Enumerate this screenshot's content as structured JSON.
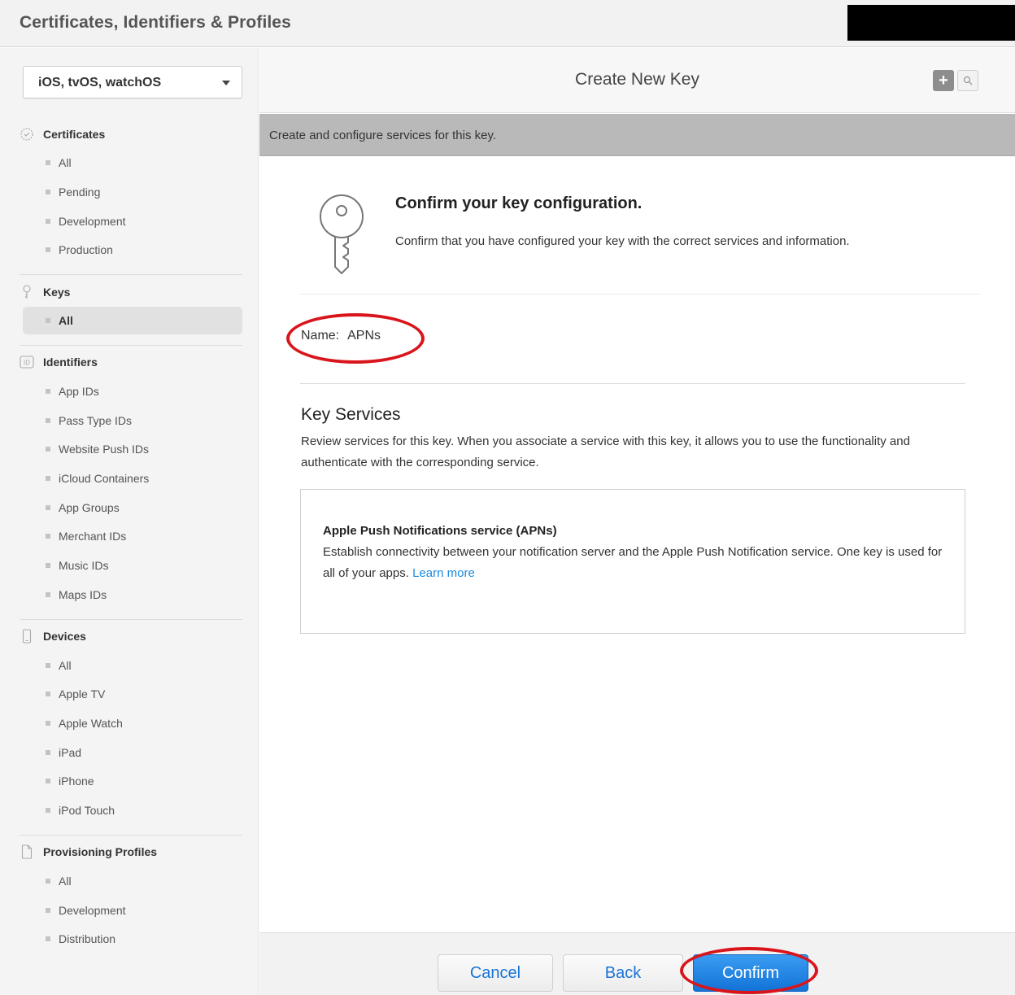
{
  "app_title": "Certificates, Identifiers & Profiles",
  "colors": {
    "annotation": "#d9151c",
    "link": "#1a8be0",
    "primary_button": "#1a74d6"
  },
  "sidebar": {
    "platform_selector": {
      "selected": "iOS, tvOS, watchOS",
      "icon": "chevron-down-icon"
    },
    "sections": [
      {
        "label": "Certificates",
        "icon": "certificate-icon",
        "items": [
          "All",
          "Pending",
          "Development",
          "Production"
        ]
      },
      {
        "label": "Keys",
        "icon": "key-icon",
        "items": [
          "All"
        ],
        "active_item": "All"
      },
      {
        "label": "Identifiers",
        "icon": "id-icon",
        "icon_text": "ID",
        "items": [
          "App IDs",
          "Pass Type IDs",
          "Website Push IDs",
          "iCloud Containers",
          "App Groups",
          "Merchant IDs",
          "Music IDs",
          "Maps IDs"
        ]
      },
      {
        "label": "Devices",
        "icon": "device-icon",
        "items": [
          "All",
          "Apple TV",
          "Apple Watch",
          "iPad",
          "iPhone",
          "iPod Touch"
        ]
      },
      {
        "label": "Provisioning Profiles",
        "icon": "document-icon",
        "items": [
          "All",
          "Development",
          "Distribution"
        ]
      }
    ]
  },
  "main": {
    "title": "Create New Key",
    "header_buttons": {
      "add": "+",
      "add_icon": "plus-icon",
      "search_icon": "search-icon"
    },
    "subheader": "Create and configure services for this key.",
    "confirm": {
      "icon": "key-icon",
      "title": "Confirm your key configuration.",
      "description": "Confirm that you have configured your key with the correct services and information."
    },
    "name": {
      "label": "Name:",
      "value": "APNs"
    },
    "key_services": {
      "title": "Key Services",
      "description": "Review services for this key. When you associate a service with this key, it allows you to use the functionality and authenticate with the corresponding service.",
      "service": {
        "title": "Apple Push Notifications service (APNs)",
        "description": "Establish connectivity between your notification server and the Apple Push Notification service. One key is used for all of your apps.",
        "link": "Learn more"
      }
    }
  },
  "footer": {
    "cancel": "Cancel",
    "back": "Back",
    "confirm": "Confirm"
  }
}
